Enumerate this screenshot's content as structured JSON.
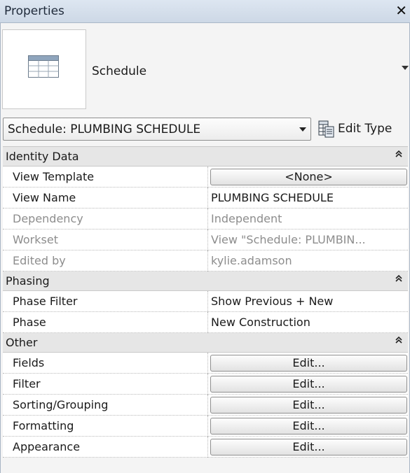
{
  "panel": {
    "title": "Properties"
  },
  "type_selector": {
    "family_name": "Schedule",
    "icon": "schedule-table-icon"
  },
  "instance": {
    "selected": "Schedule: PLUMBING SCHEDULE",
    "edit_type_label": "Edit Type"
  },
  "sections": [
    {
      "name": "Identity Data",
      "rows": [
        {
          "name": "View Template",
          "value": "<None>",
          "kind": "button",
          "disabled": false
        },
        {
          "name": "View Name",
          "value": "PLUMBING SCHEDULE",
          "kind": "text",
          "disabled": false
        },
        {
          "name": "Dependency",
          "value": "Independent",
          "kind": "text",
          "disabled": true
        },
        {
          "name": "Workset",
          "value": "View \"Schedule: PLUMBIN...",
          "kind": "text",
          "disabled": true
        },
        {
          "name": "Edited by",
          "value": "kylie.adamson",
          "kind": "text",
          "disabled": true
        }
      ]
    },
    {
      "name": "Phasing",
      "rows": [
        {
          "name": "Phase Filter",
          "value": "Show Previous + New",
          "kind": "text",
          "disabled": false
        },
        {
          "name": "Phase",
          "value": "New Construction",
          "kind": "text",
          "disabled": false
        }
      ]
    },
    {
      "name": "Other",
      "rows": [
        {
          "name": "Fields",
          "value": "Edit...",
          "kind": "button",
          "disabled": false
        },
        {
          "name": "Filter",
          "value": "Edit...",
          "kind": "button",
          "disabled": false
        },
        {
          "name": "Sorting/Grouping",
          "value": "Edit...",
          "kind": "button",
          "disabled": false
        },
        {
          "name": "Formatting",
          "value": "Edit...",
          "kind": "button",
          "disabled": false
        },
        {
          "name": "Appearance",
          "value": "Edit...",
          "kind": "button",
          "disabled": false
        }
      ]
    }
  ],
  "colors": {
    "titlebar": "#cdd8e6",
    "section_header": "#e6e6e6",
    "disabled_text": "#8d8d8d"
  }
}
